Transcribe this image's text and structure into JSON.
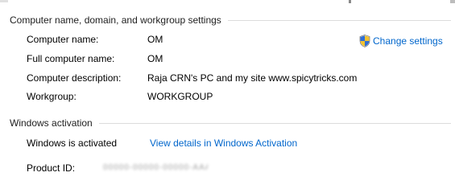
{
  "section_computer": {
    "title": "Computer name, domain, and workgroup settings",
    "rows": [
      {
        "label": "Computer name:",
        "value": "OM"
      },
      {
        "label": "Full computer name:",
        "value": "OM"
      },
      {
        "label": "Computer description:",
        "value": "Raja CRN's PC  and my site www.spicytricks.com"
      },
      {
        "label": "Workgroup:",
        "value": "WORKGROUP"
      }
    ],
    "change_settings": {
      "label": "Change settings",
      "icon": "uac-shield-icon"
    }
  },
  "section_activation": {
    "title": "Windows activation",
    "status": "Windows is activated",
    "details_link": "View details in Windows Activation",
    "product_id_label": "Product ID:",
    "product_id_value": "00000-00000-00000-AAAAA"
  },
  "colors": {
    "link": "#0066cc",
    "divider": "#dcdcdc"
  }
}
